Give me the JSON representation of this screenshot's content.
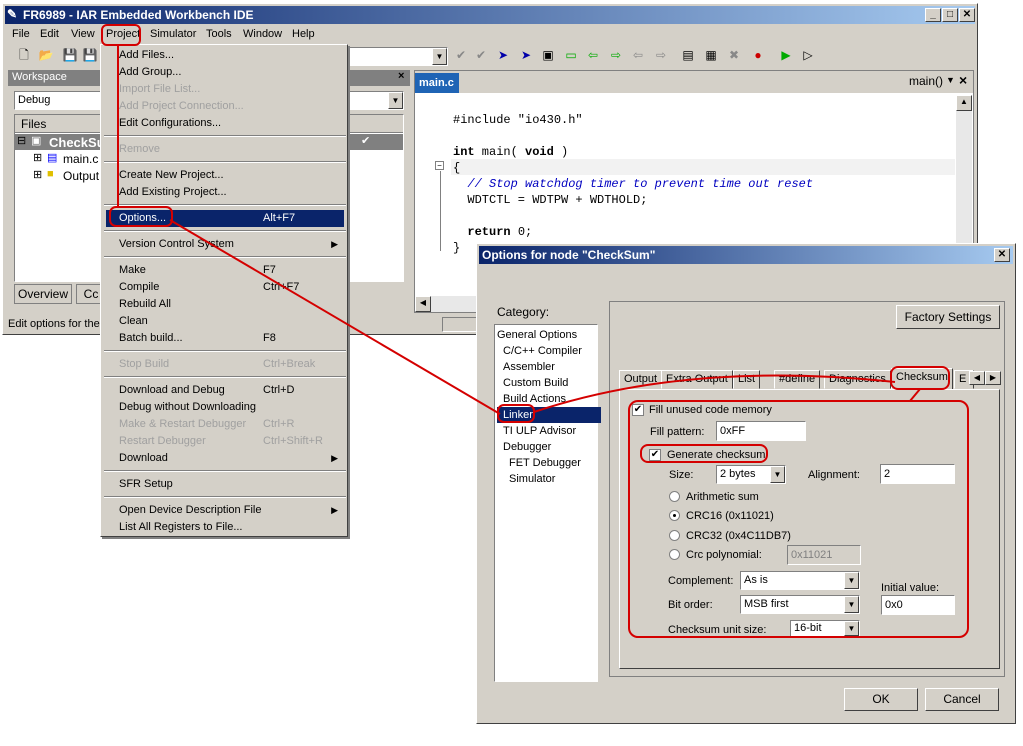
{
  "ide": {
    "title": "FR6989 - IAR Embedded Workbench IDE",
    "menubar": [
      "File",
      "Edit",
      "View",
      "Project",
      "Simulator",
      "Tools",
      "Window",
      "Help"
    ],
    "workspace": {
      "title": "Workspace",
      "config": "Debug",
      "files_header": "Files",
      "tree": [
        "CheckSum",
        "main.c",
        "Output"
      ],
      "tabs": [
        "Overview",
        "Cc"
      ]
    },
    "status": "Edit options for the",
    "editor": {
      "tab": "main.c",
      "function_combo": "main()",
      "code": [
        "#include \"io430.h\"",
        "",
        "int main( void )",
        "{",
        "  // Stop watchdog timer to prevent time out reset",
        "  WDTCTL = WDTPW + WDTHOLD;",
        "",
        "  return 0;",
        "}"
      ]
    }
  },
  "project_menu": {
    "items": [
      {
        "label": "Add Files...",
        "acc": "",
        "dis": false
      },
      {
        "label": "Add Group...",
        "acc": "",
        "dis": false
      },
      {
        "label": "Import File List...",
        "acc": "",
        "dis": true
      },
      {
        "label": "Add Project Connection...",
        "acc": "",
        "dis": true
      },
      {
        "label": "Edit Configurations...",
        "acc": "",
        "dis": false
      },
      {
        "sep": true
      },
      {
        "label": "Remove",
        "acc": "",
        "dis": true
      },
      {
        "sep": true
      },
      {
        "label": "Create New Project...",
        "acc": "",
        "dis": false
      },
      {
        "label": "Add Existing Project...",
        "acc": "",
        "dis": false
      },
      {
        "sep": true
      },
      {
        "label": "Options...",
        "acc": "Alt+F7",
        "dis": false,
        "sel": true
      },
      {
        "sep": true
      },
      {
        "label": "Version Control System",
        "acc": "",
        "dis": false,
        "sub": true
      },
      {
        "sep": true
      },
      {
        "label": "Make",
        "acc": "F7",
        "dis": false
      },
      {
        "label": "Compile",
        "acc": "Ctrl+F7",
        "dis": false
      },
      {
        "label": "Rebuild All",
        "acc": "",
        "dis": false
      },
      {
        "label": "Clean",
        "acc": "",
        "dis": false
      },
      {
        "label": "Batch build...",
        "acc": "F8",
        "dis": false
      },
      {
        "sep": true
      },
      {
        "label": "Stop Build",
        "acc": "Ctrl+Break",
        "dis": true
      },
      {
        "sep": true
      },
      {
        "label": "Download and Debug",
        "acc": "Ctrl+D",
        "dis": false
      },
      {
        "label": "Debug without Downloading",
        "acc": "",
        "dis": false
      },
      {
        "label": "Make & Restart Debugger",
        "acc": "Ctrl+R",
        "dis": true
      },
      {
        "label": "Restart Debugger",
        "acc": "Ctrl+Shift+R",
        "dis": true
      },
      {
        "label": "Download",
        "acc": "",
        "dis": false,
        "sub": true
      },
      {
        "sep": true
      },
      {
        "label": "SFR Setup",
        "acc": "",
        "dis": false
      },
      {
        "sep": true
      },
      {
        "label": "Open Device Description File",
        "acc": "",
        "dis": false,
        "sub": true
      },
      {
        "label": "List All Registers to File...",
        "acc": "",
        "dis": false
      }
    ]
  },
  "dialog": {
    "title": "Options for node \"CheckSum\"",
    "category_label": "Category:",
    "categories": [
      {
        "label": "General Options",
        "indent": 0
      },
      {
        "label": "C/C++ Compiler",
        "indent": 1
      },
      {
        "label": "Assembler",
        "indent": 1
      },
      {
        "label": "Custom Build",
        "indent": 1
      },
      {
        "label": "Build Actions",
        "indent": 1
      },
      {
        "label": "Linker",
        "indent": 1,
        "sel": true
      },
      {
        "label": "TI ULP Advisor",
        "indent": 1
      },
      {
        "label": "Debugger",
        "indent": 1
      },
      {
        "label": "FET Debugger",
        "indent": 2
      },
      {
        "label": "Simulator",
        "indent": 2
      }
    ],
    "factory_settings": "Factory Settings",
    "tabs": [
      "Output",
      "Extra Output",
      "List",
      "#define",
      "Diagnostics",
      "Checksum",
      "E"
    ],
    "fill_unused": "Fill unused code memory",
    "fill_pattern_label": "Fill pattern:",
    "fill_pattern": "0xFF",
    "generate_checksum": "Generate checksum",
    "size_label": "Size:",
    "size_value": "2 bytes",
    "alignment_label": "Alignment:",
    "alignment_value": "2",
    "radios": [
      "Arithmetic sum",
      "CRC16 (0x11021)",
      "CRC32 (0x4C11DB7)",
      "Crc polynomial:"
    ],
    "crc_poly": "0x11021",
    "complement_label": "Complement:",
    "complement_value": "As is",
    "bit_order_label": "Bit order:",
    "bit_order_value": "MSB first",
    "initial_value_label": "Initial value:",
    "initial_value": "0x0",
    "unit_size_label": "Checksum unit size:",
    "unit_size_value": "16-bit",
    "ok": "OK",
    "cancel": "Cancel"
  },
  "annotation_color": "#d40000"
}
